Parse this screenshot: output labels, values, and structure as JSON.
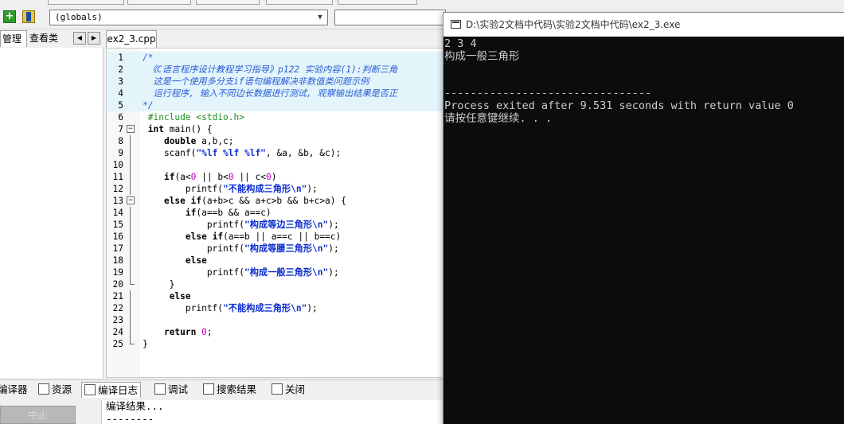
{
  "toolbar": {
    "scope_combo": "(globals)"
  },
  "left_panel": {
    "tabs": [
      "管理",
      "查看类"
    ]
  },
  "editor": {
    "file_tab": "ex2_3.cpp",
    "lines": [
      "/*",
      " 《C语言程序设计教程学习指导》p122 实验内容(1):判断三角",
      "  这是一个使用多分支if语句编程解决非数值类问题示例",
      "  运行程序, 输入不同边长数据进行测试, 观察输出结果是否正",
      "*/",
      " #include <stdio.h>",
      " int main() {",
      "    double a,b,c;",
      "    scanf(\"%lf %lf %lf\", &a, &b, &c);",
      "",
      "    if(a<0 || b<0 || c<0)",
      "        printf(\"不能构成三角形\\n\");",
      "    else if(a+b>c && a+c>b && b+c>a) {",
      "        if(a==b && a==c)",
      "            printf(\"构成等边三角形\\n\");",
      "        else if(a==b || a==c || b==c)",
      "            printf(\"构成等腰三角形\\n\");",
      "        else",
      "            printf(\"构成一般三角形\\n\");",
      "     }",
      "     else",
      "        printf(\"不能构成三角形\\n\");",
      "",
      "    return 0;",
      "}"
    ]
  },
  "bottom_panel": {
    "tabs": [
      "编译器",
      "资源",
      "编译日志",
      "调试",
      "搜索结果",
      "关闭"
    ],
    "selected_tab": "编译日志",
    "stop_button": "中止",
    "output_lines": [
      "编译结果...",
      "--------"
    ]
  },
  "console": {
    "title": "D:\\实验2文档中代码\\实验2文档中代码\\ex2_3.exe",
    "lines": [
      "2 3 4",
      "构成一般三角形",
      "",
      "--------------------------------",
      "Process exited after 9.531 seconds with return value 0",
      "请按任意键继续. . ."
    ]
  },
  "colors": {
    "console_bg": "#0c0c0c",
    "console_text": "#cccccc",
    "comment": "#2a5bd7",
    "string": "#0a2ccf",
    "preprocessor": "#1d8a1d",
    "current_line": "#e3f5fb"
  }
}
